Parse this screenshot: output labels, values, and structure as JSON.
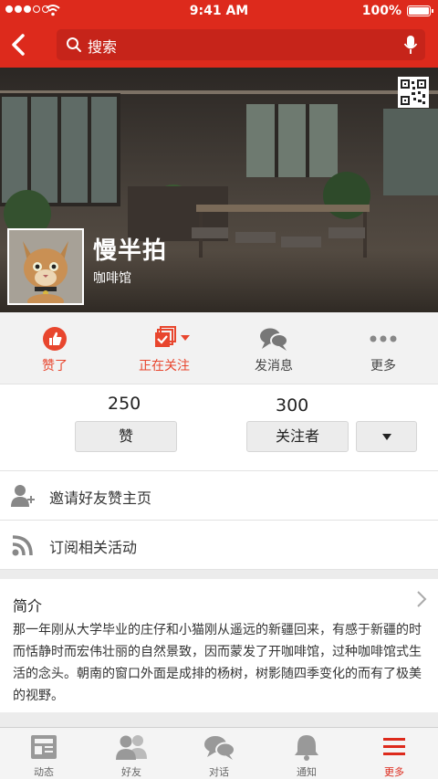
{
  "status_bar": {
    "time": "9:41 AM",
    "battery": "100%"
  },
  "nav": {
    "search_placeholder": "搜索"
  },
  "profile": {
    "name": "慢半拍",
    "category": "咖啡馆"
  },
  "actions": [
    {
      "label": "赞了",
      "icon": "thumbs-up-icon",
      "color": "#e8462e"
    },
    {
      "label": "正在关注",
      "icon": "following-icon",
      "color": "#e8462e"
    },
    {
      "label": "发消息",
      "icon": "message-icon",
      "color": "#444444"
    },
    {
      "label": "更多",
      "icon": "more-icon",
      "color": "#444444"
    }
  ],
  "stats": {
    "likes": {
      "count": "250",
      "button": "赞"
    },
    "followers": {
      "count": "300",
      "button": "关注者"
    }
  },
  "list": [
    {
      "label": "邀请好友赞主页",
      "icon": "add-friend-icon"
    },
    {
      "label": "订阅相关活动",
      "icon": "rss-icon"
    }
  ],
  "intro": {
    "title": "简介",
    "text": "那一年刚从大学毕业的庄仔和小猫刚从遥远的新疆回来，有感于新疆的时而恬静时而宏伟壮丽的自然景致，因而蒙发了开咖啡馆，过种咖啡馆式生活的念头。朝南的窗口外面是成排的杨树，树影随四季变化的而有了极美的视野。"
  },
  "tabs": [
    {
      "label": "动态",
      "icon": "news-icon"
    },
    {
      "label": "好友",
      "icon": "friends-icon"
    },
    {
      "label": "对话",
      "icon": "chat-icon"
    },
    {
      "label": "通知",
      "icon": "bell-icon"
    },
    {
      "label": "更多",
      "icon": "menu-icon",
      "active": true
    }
  ],
  "colors": {
    "brand": "#dd2a1c",
    "accent": "#e8462e"
  }
}
